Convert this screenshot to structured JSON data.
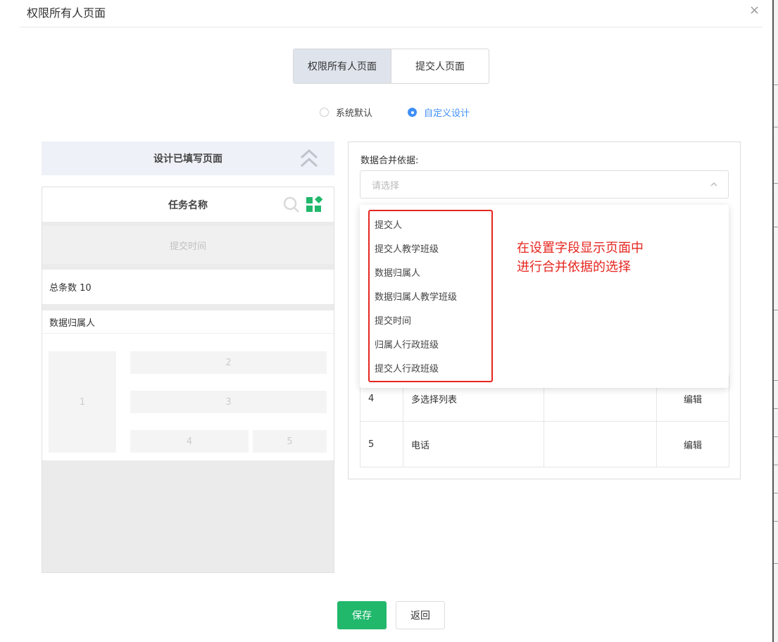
{
  "dialog": {
    "title": "权限所有人页面",
    "close_icon": "×"
  },
  "tabs": [
    {
      "label": "权限所有人页面",
      "active": true
    },
    {
      "label": "提交人页面",
      "active": false
    }
  ],
  "radios": [
    {
      "label": "系统默认",
      "checked": false
    },
    {
      "label": "自定义设计",
      "checked": true
    }
  ],
  "left": {
    "design_bar": "设计已填写页面",
    "phone": {
      "header": "任务名称",
      "submit_time": "提交时间",
      "total": "总条数 10",
      "owner": "数据归属人",
      "cells": [
        "1",
        "2",
        "3",
        "4",
        "5"
      ]
    }
  },
  "right": {
    "merge_label": "数据合并依据:",
    "select_placeholder": "请选择",
    "dropdown_options": [
      "提交人",
      "提交人教学班级",
      "数据归属人",
      "数据归属人教学班级",
      "提交时间",
      "归属人行政班级",
      "提交人行政班级"
    ],
    "rows": [
      {
        "index": "4",
        "name": "多选择列表",
        "extra": "",
        "action": "编辑"
      },
      {
        "index": "5",
        "name": "电话",
        "extra": "",
        "action": "编辑"
      }
    ]
  },
  "annotation": {
    "line1": "在设置字段显示页面中",
    "line2": "进行合并依据的选择"
  },
  "footer": {
    "save": "保存",
    "back": "返回"
  },
  "colors": {
    "primary_green": "#21b86c",
    "radio_blue": "#3f8ff7",
    "annotation_red": "#e5261f",
    "tab_active_bg": "#dfe4ec"
  }
}
